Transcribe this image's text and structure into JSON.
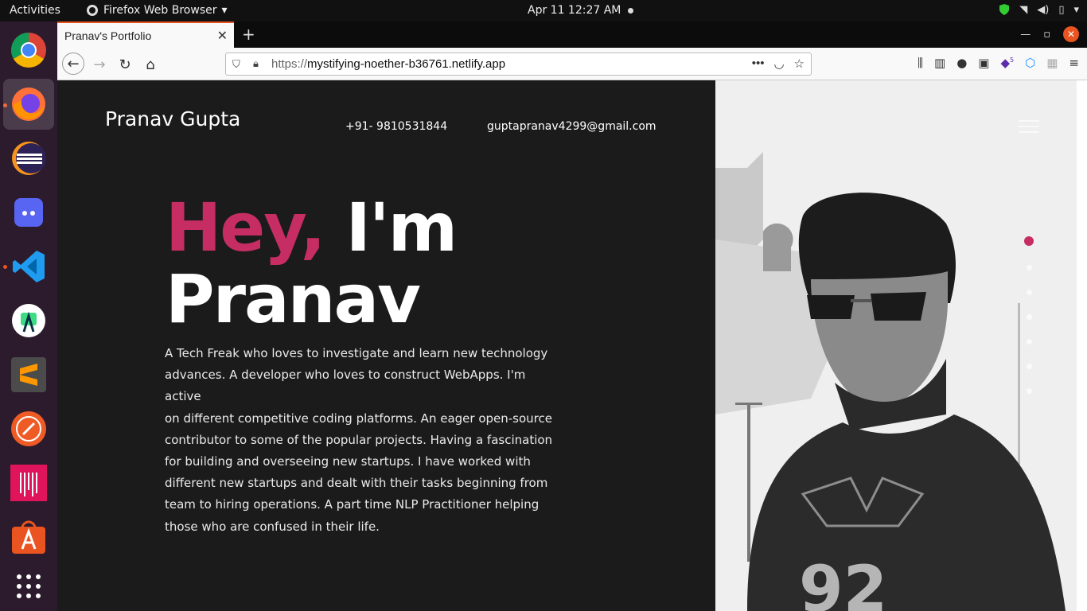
{
  "topbar": {
    "activities": "Activities",
    "app_name": "Firefox Web Browser",
    "clock": "Apr 11  12:27 AM"
  },
  "browser": {
    "tab_title": "Pranav's Portfolio",
    "url_proto": "https://",
    "url_host": "mystifying-noether-b36761.netlify.app",
    "ext_badge": "5"
  },
  "dock": {
    "items": [
      "Google Chrome",
      "Firefox",
      "Eclipse",
      "Discord",
      "Visual Studio Code",
      "Android Studio",
      "Sublime Text",
      "Postman",
      "GitKraken",
      "Ubuntu Software",
      "Show Applications"
    ]
  },
  "site": {
    "brand": "Pranav Gupta",
    "phone": "+91- 9810531844",
    "email": "guptapranav4299@gmail.com",
    "hero_accent": "Hey,",
    "hero_rest": " I'm",
    "hero_name": "Pranav",
    "bio_lines": [
      "A Tech Freak who loves to investigate and learn new technology",
      "advances. A developer who loves to construct WebApps. I'm active",
      "on different competitive coding platforms. An eager open-source",
      "contributor to some of the popular projects. Having a fascination",
      "for building and overseeing new startups. I have worked with",
      "different new startups and dealt with their tasks beginning from",
      "team to hiring operations. A part time NLP Practitioner helping",
      "those who are confused in their life."
    ],
    "photo_shirt_number": "92"
  },
  "colors": {
    "accent": "#c62d63",
    "ubuntu_orange": "#e95420"
  }
}
